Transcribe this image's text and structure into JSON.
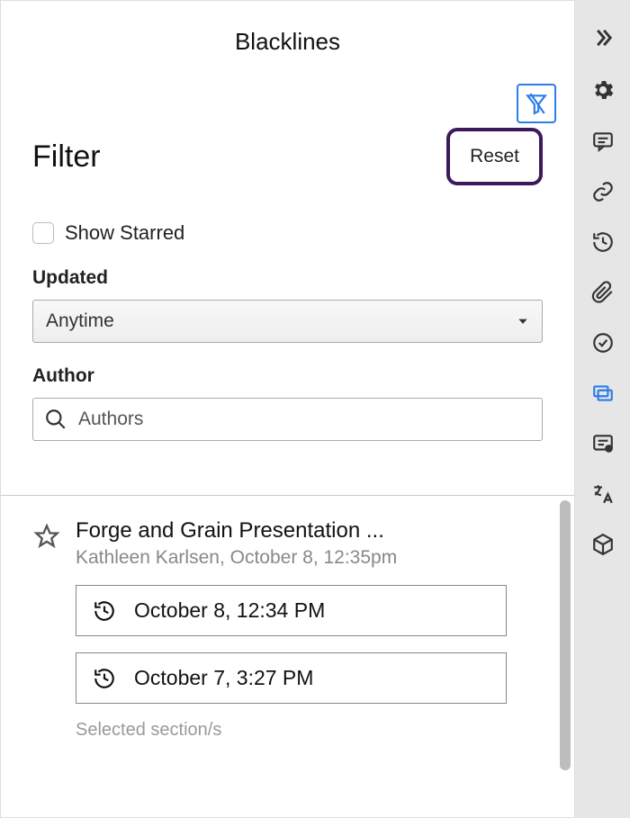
{
  "panelTitle": "Blacklines",
  "filter": {
    "title": "Filter",
    "resetLabel": "Reset",
    "showStarredLabel": "Show Starred",
    "updatedLabel": "Updated",
    "updatedValue": "Anytime",
    "authorLabel": "Author",
    "authorPlaceholder": "Authors"
  },
  "item": {
    "title": "Forge and Grain Presentation ...",
    "meta": "Kathleen Karlsen, October 8, 12:35pm",
    "rev1": "October 8, 12:34 PM",
    "rev2": "October 7, 3:27 PM",
    "selectedLabel": "Selected section/s"
  }
}
